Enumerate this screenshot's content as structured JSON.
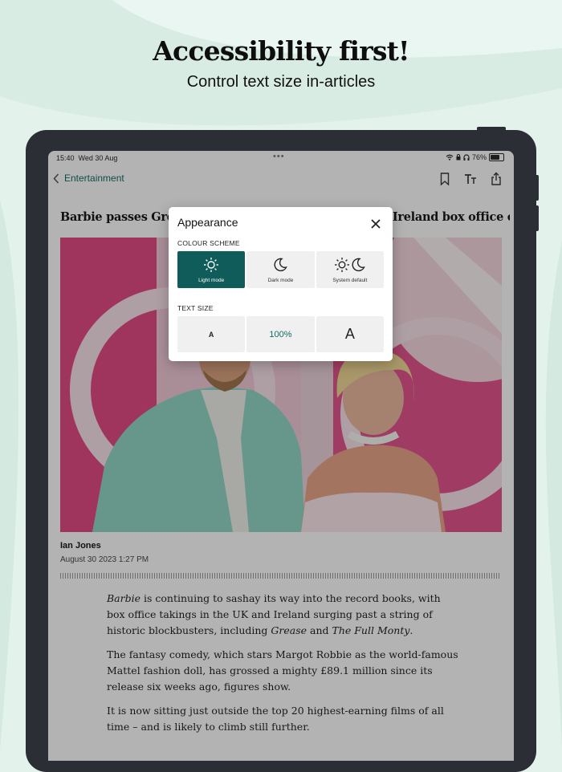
{
  "promo": {
    "title": "Accessibility first!",
    "subtitle": "Control text size in-articles"
  },
  "status_bar": {
    "time": "15:40",
    "date": "Wed 30 Aug",
    "dots": "•••",
    "battery": "76%",
    "battery_level": 0.76
  },
  "nav": {
    "back_label": "Entertainment",
    "icons": [
      "bookmark-icon",
      "text-size-icon",
      "share-icon"
    ]
  },
  "article": {
    "headline": "Barbie passes Grease and The Full Monty in UK and Ireland box office chart",
    "author": "Ian Jones",
    "date": "August 30 2023 1:27 PM",
    "paragraphs": [
      {
        "p1_a": "Barbie",
        "p1_b": " is continuing to sashay its way into the record books, with box office takings in the UK and Ireland surging past a string of historic blockbusters, including ",
        "p1_c": "Grease",
        "p1_d": " and ",
        "p1_e": "The Full Monty",
        "p1_f": "."
      },
      {
        "text": "The fantasy comedy, which stars Margot Robbie as the world-famous Mattel fashion doll, has grossed a mighty £89.1 million since its release six weeks ago, figures show."
      },
      {
        "text": "It is now sitting just outside the top 20 highest-earning films of all time – and is likely to climb still further."
      }
    ]
  },
  "appearance_modal": {
    "title": "Appearance",
    "colour_scheme_label": "COLOUR SCHEME",
    "schemes": [
      {
        "label": "Light mode",
        "icon": "sun-icon",
        "selected": true
      },
      {
        "label": "Dark mode",
        "icon": "moon-icon",
        "selected": false
      },
      {
        "label": "System default",
        "icon": "sun-moon-icon",
        "selected": false
      }
    ],
    "text_size_label": "TEXT SIZE",
    "text_size": {
      "decrease": "A",
      "current": "100%",
      "increase": "A"
    }
  },
  "colors": {
    "accent": "#136b62",
    "selected_bg": "#0f5c5a",
    "background": "#e4f2ec",
    "device": "#2b2e35"
  }
}
